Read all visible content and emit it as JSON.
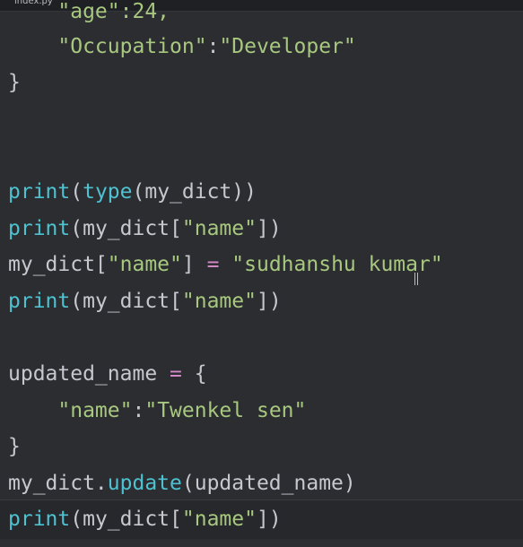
{
  "tab": {
    "filename": "index.py"
  },
  "lines": {
    "l1": {
      "text": "    \"age\":24,"
    },
    "l2": {
      "key": "\"Occupation\"",
      "colon": ":",
      "value": "\"Developer\""
    },
    "l3": {
      "brace": "}"
    },
    "l4": {
      "fn": "print",
      "p1": "(",
      "fn2": "type",
      "rest": "(my_dict))"
    },
    "l5": {
      "fn": "print",
      "a": "(my_dict[",
      "str": "\"name\"",
      "b": "])"
    },
    "l6": {
      "a": "my_dict[",
      "str": "\"name\"",
      "b": "] ",
      "op": "=",
      "c": " ",
      "value": "\"sudhanshu kumar\""
    },
    "l7": {
      "fn": "print",
      "a": "(my_dict[",
      "str": "\"name\"",
      "b": "])"
    },
    "l8": {
      "a": "updated_name ",
      "op": "=",
      "b": " {"
    },
    "l9": {
      "key": "\"name\"",
      "colon": ":",
      "value": "\"Twenkel sen\""
    },
    "l10": {
      "brace": "}"
    },
    "l11": {
      "a": "my_dict.",
      "fn": "update",
      "b": "(updated_name)"
    },
    "l12": {
      "fn": "print",
      "a": "(my_dict[",
      "str": "\"name\"",
      "b": "])"
    }
  },
  "colors": {
    "background": "#2b2d31",
    "function": "#4ec2d0",
    "string": "#a8c77f",
    "operator": "#d389c8",
    "text": "#c5c8ce"
  }
}
